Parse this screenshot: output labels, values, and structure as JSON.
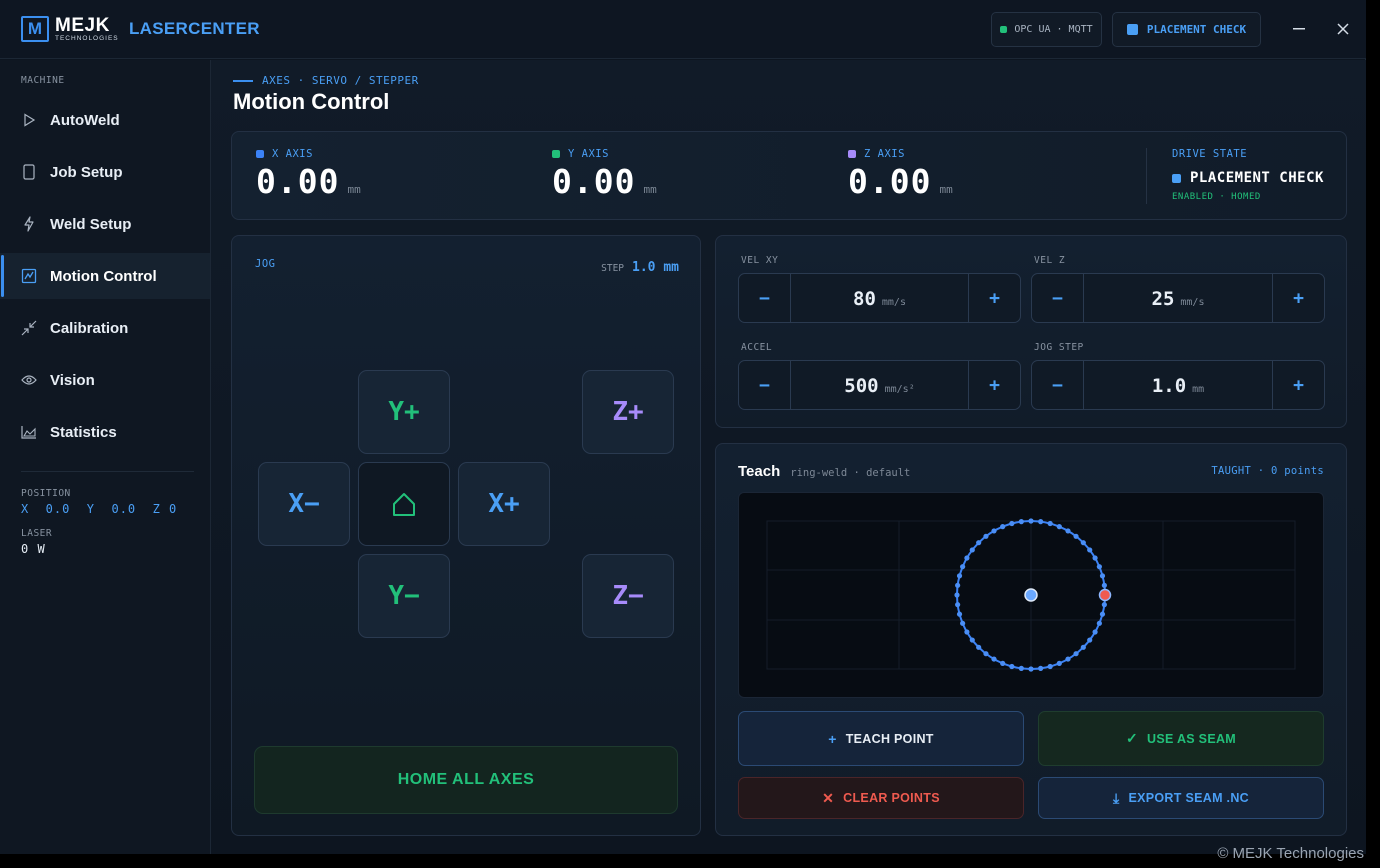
{
  "titlebar": {
    "logo_mark": "M",
    "logo_name": "MEJK",
    "logo_sub": "TECHNOLOGIES",
    "app_name": "LASERCENTER",
    "protocol_chip": "OPC UA · MQTT",
    "state_chip": "PLACEMENT CHECK",
    "minimize": "—",
    "close": "✕"
  },
  "sidebar": {
    "section": "MACHINE",
    "items": [
      {
        "label": "AutoWeld",
        "icon": "play-icon"
      },
      {
        "label": "Job Setup",
        "icon": "document-icon"
      },
      {
        "label": "Weld Setup",
        "icon": "bolt-icon"
      },
      {
        "label": "Motion Control",
        "icon": "chart-icon",
        "active": true
      },
      {
        "label": "Calibration",
        "icon": "collapse-arrows-icon"
      },
      {
        "label": "Vision",
        "icon": "eye-icon"
      },
      {
        "label": "Statistics",
        "icon": "area-chart-icon"
      }
    ],
    "position_label": "POSITION",
    "position_value": "X  0.0  Y  0.0  Z 0",
    "laser_label": "LASER",
    "laser_value": "0 W"
  },
  "header": {
    "breadcrumb": "AXES · SERVO / STEPPER",
    "title": "Motion Control"
  },
  "axes": [
    {
      "label": "X AXIS",
      "value": "0.00",
      "unit": "mm",
      "color": "#3b82f6"
    },
    {
      "label": "Y AXIS",
      "value": "0.00",
      "unit": "mm",
      "color": "#22c07a"
    },
    {
      "label": "Z AXIS",
      "value": "0.00",
      "unit": "mm",
      "color": "#a78bfa"
    }
  ],
  "drive": {
    "label": "DRIVE STATE",
    "state": "PLACEMENT CHECK",
    "sub": "ENABLED · HOMED"
  },
  "jog": {
    "title": "JOG",
    "step_label": "STEP",
    "step_value": "1.0 mm",
    "buttons": {
      "y_plus": "Y+",
      "y_minus": "Y−",
      "x_plus": "X+",
      "x_minus": "X−",
      "z_plus": "Z+",
      "z_minus": "Z−",
      "home": "⌂"
    },
    "home_all": "HOME ALL AXES"
  },
  "params": {
    "vel_xy": {
      "label": "VEL XY",
      "value": "80",
      "unit": "mm/s"
    },
    "vel_z": {
      "label": "VEL Z",
      "value": "25",
      "unit": "mm/s"
    },
    "accel": {
      "label": "ACCEL",
      "value": "500",
      "unit": "mm/s²"
    },
    "jog_step": {
      "label": "JOG STEP",
      "value": "1.0",
      "unit": "mm"
    },
    "minus": "−",
    "plus": "+"
  },
  "teach": {
    "title": "Teach",
    "subtitle": "ring-weld · default",
    "count": "TAUGHT · 0 points",
    "teach_point": "TEACH POINT",
    "use_as_seam": "USE AS SEAM",
    "clear_points": "CLEAR POINTS",
    "export_seam": "EXPORT SEAM .NC",
    "glyph_plus": "+",
    "glyph_check": "✓",
    "glyph_x": "✕",
    "glyph_download": "⤓"
  },
  "colors": {
    "accent": "#4a9ff5",
    "green": "#22c07a",
    "purple": "#a78bfa",
    "red": "#ef5a4f"
  },
  "footer": "© MEJK Technologies"
}
